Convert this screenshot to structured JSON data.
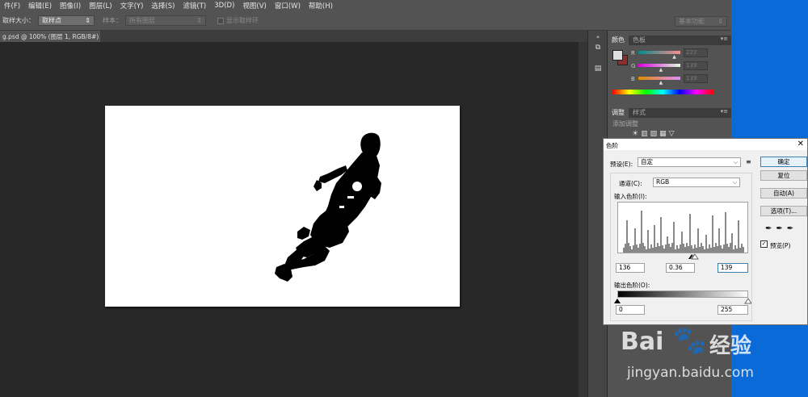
{
  "menubar": [
    "件(F)",
    "编辑(E)",
    "图像(I)",
    "图层(L)",
    "文字(Y)",
    "选择(S)",
    "滤镜(T)",
    "3D(D)",
    "视图(V)",
    "窗口(W)",
    "帮助(H)"
  ],
  "options": {
    "sample_size_label": "取样大小：",
    "sample_size_value": "取样点",
    "sample_label": "样本：",
    "sample_value": "所有图层",
    "show_ring_label": "显示取样环",
    "workspace": "基本功能"
  },
  "document_tab": "g.psd @ 100% (图层 1, RGB/8#) *",
  "panels": {
    "color_tabs": [
      "颜色",
      "色板"
    ],
    "rgb": [
      {
        "label": "R",
        "value": "223",
        "pos": 0.87
      },
      {
        "label": "G",
        "value": "139",
        "pos": 0.55
      },
      {
        "label": "B",
        "value": "139",
        "pos": 0.55
      }
    ],
    "adjust_tabs": [
      "调整",
      "样式"
    ],
    "add_adjustment": "添加调整"
  },
  "colors": {
    "foreground": "#dfdfdf",
    "background": "#8b2e2e",
    "desktop": "#0a6ad8"
  },
  "levels_dialog": {
    "title": "色阶",
    "preset_label": "预设(E):",
    "preset_value": "自定",
    "channel_label": "通道(C):",
    "channel_value": "RGB",
    "input_label": "输入色阶(I):",
    "input_values": [
      "136",
      "0.36",
      "139"
    ],
    "output_label": "输出色阶(O):",
    "output_values": [
      "0",
      "255"
    ],
    "buttons": {
      "ok": "确定",
      "reset": "复位",
      "auto": "自动(A)",
      "options": "选项(T)...",
      "preview": "预览(P)"
    },
    "preview_checked": true
  },
  "watermark": {
    "brand_latin": "Bai",
    "brand_cn": "经验",
    "url": "jingyan.baidu.com"
  }
}
